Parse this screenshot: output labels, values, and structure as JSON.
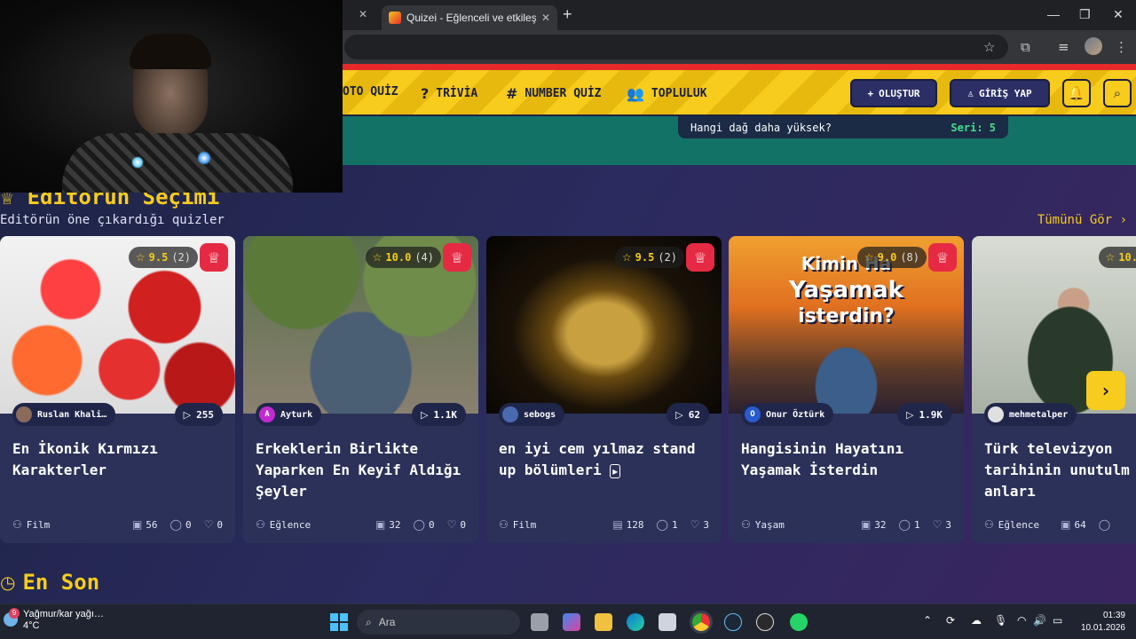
{
  "browser": {
    "tab_title": "Quizei - Eğlenceli ve etkileşimli",
    "tab_close": "✕",
    "new_tab": "+"
  },
  "nav": {
    "items": [
      {
        "label": "OTO QUİZ",
        "icon": "photo-icon"
      },
      {
        "label": "TRİVİA",
        "icon": "question-icon"
      },
      {
        "label": "NUMBER QUİZ",
        "icon": "hash-icon"
      },
      {
        "label": "TOPLULUK",
        "icon": "users-icon"
      }
    ],
    "create_label": "OLUŞTUR",
    "login_label": "GİRİŞ YAP"
  },
  "hero": {
    "question": "Hangi dağ daha yüksek?",
    "streak": "Seri: 5"
  },
  "section": {
    "title": "Editörün Seçimi",
    "subtitle": "Editörün öne çıkardığı quizler",
    "see_all": "Tümünü Gör"
  },
  "cards": [
    {
      "rating": "9.5",
      "rating_count": "(2)",
      "author": "Ruslan Khali…",
      "author_initial": "",
      "plays": "255",
      "title": "En İkonik Kırmızı Karakterler",
      "category": "Film",
      "questions": "56",
      "comments": "0",
      "likes": "0"
    },
    {
      "rating": "10.0",
      "rating_count": "(4)",
      "author": "Ayturk",
      "author_initial": "A",
      "plays": "1.1K",
      "title": "Erkeklerin Birlikte Yaparken En Keyif Aldığı Şeyler",
      "category": "Eğlence",
      "questions": "32",
      "comments": "0",
      "likes": "0"
    },
    {
      "rating": "9.5",
      "rating_count": "(2)",
      "author": "sebogs",
      "author_initial": "",
      "plays": "62",
      "title": "en iyi cem yılmaz stand up bölümleri",
      "category": "Film",
      "questions": "128",
      "comments": "1",
      "likes": "3"
    },
    {
      "rating": "9.0",
      "rating_count": "(8)",
      "author": "Onur Öztürk",
      "author_initial": "O",
      "plays": "1.9K",
      "title": "Hangisinin Hayatını Yaşamak İsterdin",
      "category": "Yaşam",
      "questions": "32",
      "comments": "1",
      "likes": "3"
    },
    {
      "rating": "10.",
      "rating_count": "",
      "author": "mehmetalper",
      "author_initial": "",
      "plays": "",
      "title": "Türk televizyon tarihinin unutulm anları",
      "category": "Eğlence",
      "questions": "64",
      "comments": "",
      "likes": ""
    }
  ],
  "thumb_text": {
    "card4_line1": "Kimin Ha",
    "card4_line2": "Yaşamak",
    "card4_line3": "isterdin?"
  },
  "section2": {
    "title": "En Son"
  },
  "taskbar": {
    "weather_line1": "Yağmur/kar yağı…",
    "weather_line2": "4°C",
    "weather_badge": "9",
    "search_placeholder": "Ara",
    "time": "01:39",
    "date": "10.01.2026"
  },
  "colors": {
    "accent_yellow": "#f7cc1c",
    "accent_red": "#e62a2a",
    "hero_teal": "#137266",
    "card_bg": "#2b3158"
  }
}
